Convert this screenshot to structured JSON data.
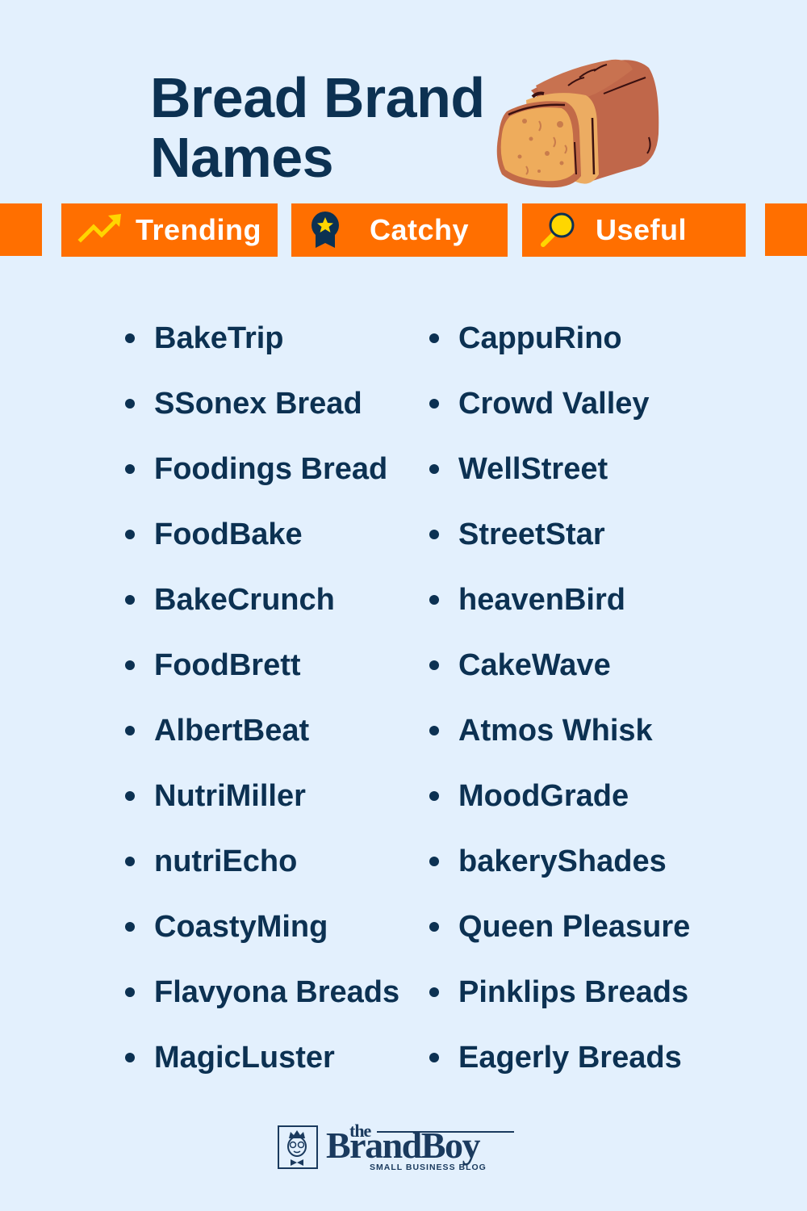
{
  "header": {
    "title_line1": "Bread Brand",
    "title_line2": "Names",
    "illustration": "bread-loaf-icon"
  },
  "tabs": [
    {
      "label": "Trending",
      "icon": "trending-up-icon"
    },
    {
      "label": "Catchy",
      "icon": "award-badge-icon"
    },
    {
      "label": "Useful",
      "icon": "magnifier-icon"
    }
  ],
  "names": {
    "column1": [
      "BakeTrip",
      "SSonex Bread",
      "Foodings Bread",
      "FoodBake",
      "BakeCrunch",
      "FoodBrett",
      "AlbertBeat",
      "NutriMiller",
      "nutriEcho",
      "CoastyMing",
      "Flavyona Breads",
      "MagicLuster"
    ],
    "column2": [
      "CappuRino",
      "Crowd Valley",
      "WellStreet",
      "StreetStar",
      "heavenBird",
      "CakeWave",
      "Atmos Whisk",
      "MoodGrade",
      "bakeryShades",
      "Queen Pleasure",
      "Pinklips Breads",
      "Eagerly Breads"
    ]
  },
  "footer": {
    "logo_the": "the",
    "logo_brand": "BrandBoy",
    "logo_tagline": "SMALL BUSINESS BLOG"
  },
  "colors": {
    "background": "#e3f0fd",
    "text": "#0c3152",
    "accent": "#ff6f00",
    "icon_yellow": "#ffd600"
  }
}
